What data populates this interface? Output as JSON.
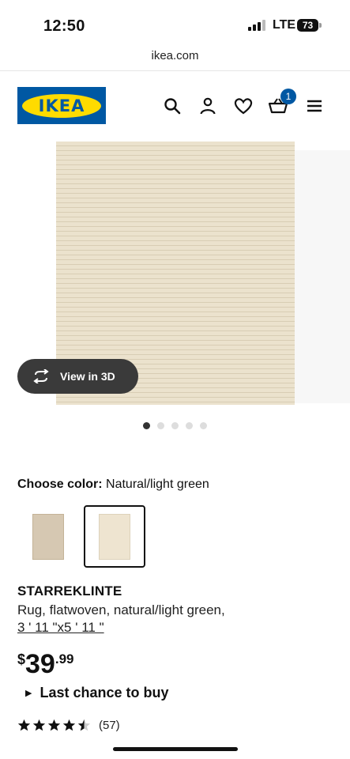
{
  "status_bar": {
    "time": "12:50",
    "network": "LTE",
    "battery": "73"
  },
  "browser": {
    "url": "ikea.com"
  },
  "header": {
    "logo_text": "IKEA",
    "cart_count": "1",
    "icons": [
      "search-icon",
      "account-icon",
      "heart-icon",
      "cart-icon",
      "menu-icon"
    ],
    "brand_blue": "#0058a3",
    "brand_yellow": "#ffdb00"
  },
  "gallery": {
    "view_3d_label": "View in 3D",
    "dot_count": 5,
    "active_dot": 0
  },
  "product": {
    "choose_color_label": "Choose color:",
    "selected_color": "Natural/light green",
    "swatches": [
      {
        "name": "beige",
        "color": "#d6c8b2",
        "selected": false
      },
      {
        "name": "natural-light-green",
        "color": "#e9dfcb",
        "selected": true
      }
    ],
    "name": "STARREKLINTE",
    "description": "Rug, flatwoven, natural/light green,",
    "size": "3 ' 11 \"x5 ' 11 \"",
    "price": {
      "currency": "$",
      "whole": "39",
      "cents": ".99"
    },
    "availability": "Last chance to buy",
    "rating": 4.5,
    "review_count": "(57)"
  }
}
